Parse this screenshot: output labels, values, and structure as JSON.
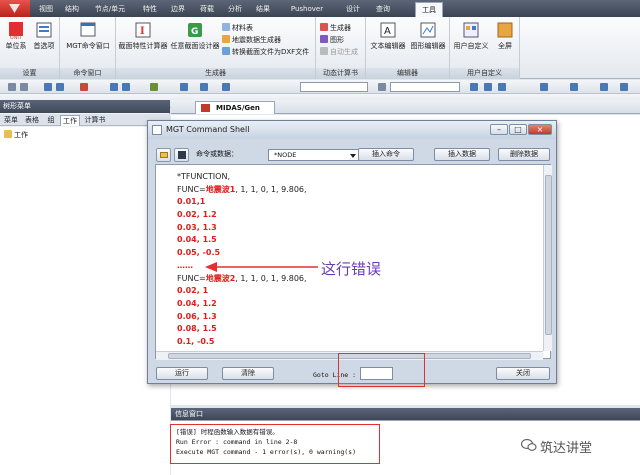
{
  "ribbon_tabs": [
    "视图",
    "结构",
    "节点/单元",
    "特性",
    "边界",
    "荷载",
    "分析",
    "结果",
    "Pushover",
    "设计",
    "查询",
    "工具"
  ],
  "ribbon_active_tab": "工具",
  "ribbon": {
    "settings": {
      "caption": "设置",
      "btn_units": "单位系",
      "btn_options": "首选项"
    },
    "cmdwin": {
      "caption": "命令窗口",
      "btn": "MGT命令窗口"
    },
    "generators": {
      "caption": "生成器",
      "btn_section": "截面特性计算器",
      "btn_arbitrary": "任意截面设计器",
      "s1": "材料表",
      "s2": "地震数据生成器",
      "s3": "转换截面文件为DXF文件"
    },
    "dynreport": {
      "caption": "动态计算书",
      "s1": "生成器",
      "s2": "图形",
      "s3": "自动生成"
    },
    "editor": {
      "caption": "编辑器",
      "btn_text": "文本编辑器",
      "btn_graph": "图形编辑器"
    },
    "custom": {
      "caption": "用户自定义",
      "btn_custom": "用户自定义",
      "btn_full": "全屏"
    }
  },
  "left_panel": {
    "title": "树形菜单",
    "tabs": [
      "菜单",
      "表格",
      "组",
      "工作",
      "计算书"
    ],
    "active_tab": "工作",
    "tree_root": "工作"
  },
  "document_tab": "MIDAS/Gen",
  "dialog": {
    "title": "MGT Command Shell",
    "cmd_label": "命令或数据：",
    "cmd_select_value": "*NODE",
    "btn_insert_cmd": "插入命令",
    "btn_insert_data": "插入数据",
    "btn_delete_data": "删除数据",
    "btn_run": "运行",
    "btn_clear": "清除",
    "goto_label": "Goto Line :",
    "btn_close": "关闭",
    "editor_lines": [
      {
        "pre": "*TFUNCTION,",
        "hl": "",
        "post": "",
        "style": "blk"
      },
      {
        "pre": "FUNC=",
        "hl": "地震波1",
        "post": ", 1, 1, 0, 1, 9.806,",
        "style": "blk"
      },
      {
        "pre": "0.01,1",
        "hl": "",
        "post": "",
        "style": "red"
      },
      {
        "pre": "0.02, 1.2",
        "hl": "",
        "post": "",
        "style": "red"
      },
      {
        "pre": "0.03, 1.3",
        "hl": "",
        "post": "",
        "style": "red"
      },
      {
        "pre": "0.04, 1.5",
        "hl": "",
        "post": "",
        "style": "red"
      },
      {
        "pre": "0.05, -0.5",
        "hl": "",
        "post": "",
        "style": "red"
      },
      {
        "pre": "……",
        "hl": "",
        "post": "",
        "style": "red"
      },
      {
        "pre": "FUNC=",
        "hl": "地震波2",
        "post": ", 1, 1, 0, 1, 9.806,",
        "style": "blk"
      },
      {
        "pre": "0.02, 1",
        "hl": "",
        "post": "",
        "style": "red"
      },
      {
        "pre": "0.04, 1.2",
        "hl": "",
        "post": "",
        "style": "red"
      },
      {
        "pre": "0.06, 1.3",
        "hl": "",
        "post": "",
        "style": "red"
      },
      {
        "pre": "0.08, 1.5",
        "hl": "",
        "post": "",
        "style": "red"
      },
      {
        "pre": "0.1, -0.5",
        "hl": "",
        "post": "",
        "style": "red"
      },
      {
        "pre": "……",
        "hl": "",
        "post": "",
        "style": "red"
      }
    ]
  },
  "annotation": "这行错误",
  "info_window": {
    "title": "信息窗口",
    "lines": [
      "[错误] 时程函数输入数据有错误。",
      "Run Error : command in line 2-8",
      "Execute MGT command - 1 error(s), 0 warning(s)"
    ]
  },
  "watermark": "筑达讲堂",
  "colors": {
    "annotation": "#6a3cb5",
    "highlight_box": "#e23030",
    "error_text": "#e21b1b"
  }
}
